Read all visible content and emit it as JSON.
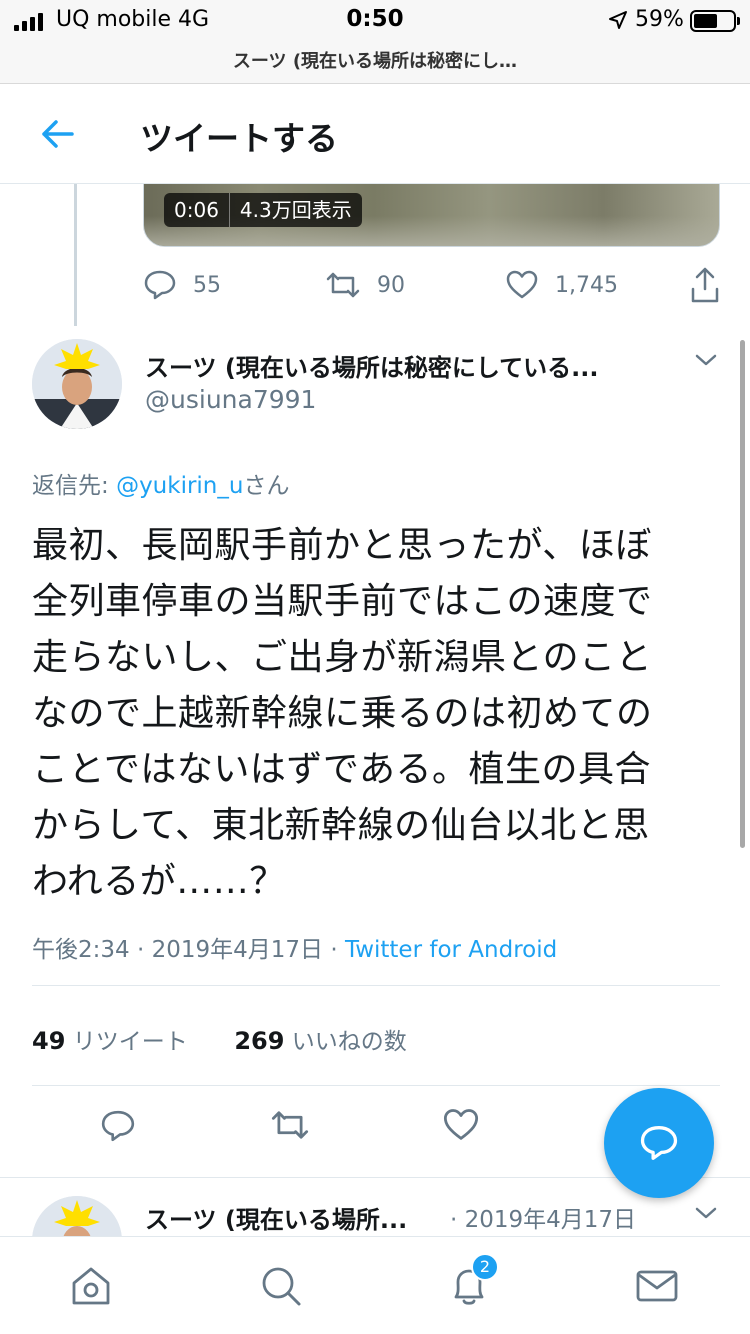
{
  "status_bar": {
    "carrier": "UQ mobile 4G",
    "time": "0:50",
    "battery_percent": "59%",
    "battery_level": 0.59
  },
  "url_bar": {
    "title": "スーツ (現在いる場所は秘密にし…"
  },
  "header": {
    "title": "ツイートする",
    "back_icon": "arrow-left-icon"
  },
  "previous_tweet": {
    "video": {
      "duration": "0:06",
      "views": "4.3万回表示"
    },
    "actions": {
      "replies": "55",
      "retweets": "90",
      "likes": "1,745"
    }
  },
  "tweet": {
    "author_name": "スーツ (現在いる場所は秘密にしている...",
    "handle": "@usiuna7991",
    "reply_prefix": "返信先: ",
    "reply_mention": "@yukirin_u",
    "reply_suffix": "さん",
    "text_lines": [
      "最初、長岡駅手前かと思ったが、ほぼ",
      "全列車停車の当駅手前ではこの速度で",
      "走らないし、ご出身が新潟県とのこと",
      "なので上越新幹線に乗るのは初めての",
      "ことではないはずである。植生の具合",
      "からして、東北新幹線の仙台以北と思",
      "われるが……？"
    ],
    "time": "午後2:34 · 2019年4月17日 · ",
    "source": "Twitter for Android",
    "retweet_count": "49",
    "retweet_label": "リツイート",
    "like_count": "269",
    "like_label": "いいねの数"
  },
  "next_tweet": {
    "author_name": "スーツ (現在いる場所...",
    "date": "· 2019年4月17日"
  },
  "bottom_nav": {
    "notification_badge": "2",
    "items": [
      "home-icon",
      "search-icon",
      "notifications-icon",
      "messages-icon"
    ]
  },
  "colors": {
    "accent": "#1da1f2",
    "text": "#14171a",
    "muted": "#657786",
    "border": "#e1e8ed"
  }
}
